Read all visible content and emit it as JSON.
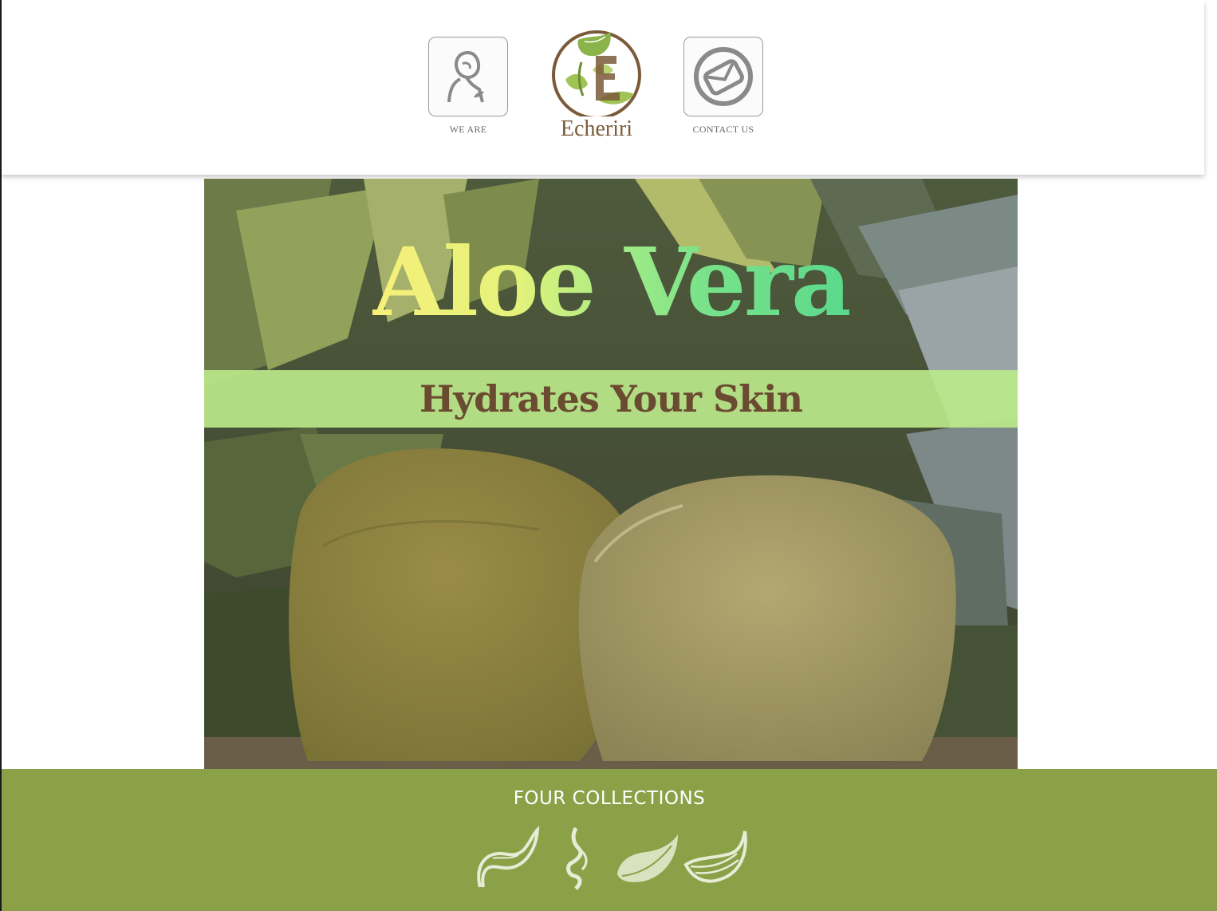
{
  "header": {
    "nav_left": {
      "label": "WE ARE",
      "icon": "person-icon"
    },
    "logo": {
      "brand": "Echeriri",
      "icon": "leaf-e-logo-icon"
    },
    "nav_right": {
      "label": "CONTACT US",
      "icon": "envelope-icon"
    }
  },
  "hero": {
    "title": "Aloe Vera",
    "subtitle": "Hydrates Your Skin",
    "colors": {
      "band": "#bdeb8c",
      "subtitle": "#6a4a30"
    }
  },
  "footer": {
    "title": "FOUR COLLECTIONS",
    "background": "#8ba148",
    "collections": [
      {
        "icon": "leaf-wave-icon"
      },
      {
        "icon": "leaf-spiral-icon"
      },
      {
        "icon": "leaf-drop-icon"
      },
      {
        "icon": "leaf-feather-icon"
      }
    ]
  }
}
